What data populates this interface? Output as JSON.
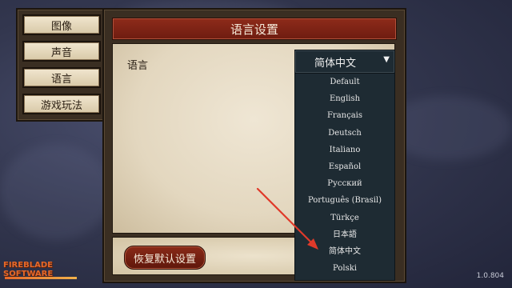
{
  "tabs": [
    {
      "label": "图像"
    },
    {
      "label": "声音"
    },
    {
      "label": "语言"
    },
    {
      "label": "游戏玩法"
    }
  ],
  "panel": {
    "title": "语言设置",
    "language_label": "语言",
    "reset_label": "恢复默认设置"
  },
  "language_dropdown": {
    "selected": "简体中文",
    "arrow": "▼",
    "options": [
      {
        "label": "Default"
      },
      {
        "label": "English"
      },
      {
        "label": "Français"
      },
      {
        "label": "Deutsch"
      },
      {
        "label": "Italiano"
      },
      {
        "label": "Español"
      },
      {
        "label": "Русский"
      },
      {
        "label": "Português (Brasil)"
      },
      {
        "label": "Türkçe"
      },
      {
        "label": "日本語"
      },
      {
        "label": "简体中文"
      },
      {
        "label": "Polski"
      }
    ]
  },
  "logo": {
    "wordmark": "FIREBLADE SOFTWARE"
  },
  "version": "1.0.804",
  "colors": {
    "accent_red": "#8e2b1a",
    "annotation_arrow": "#e03a2a",
    "dropdown_bg": "#1e2b33"
  }
}
